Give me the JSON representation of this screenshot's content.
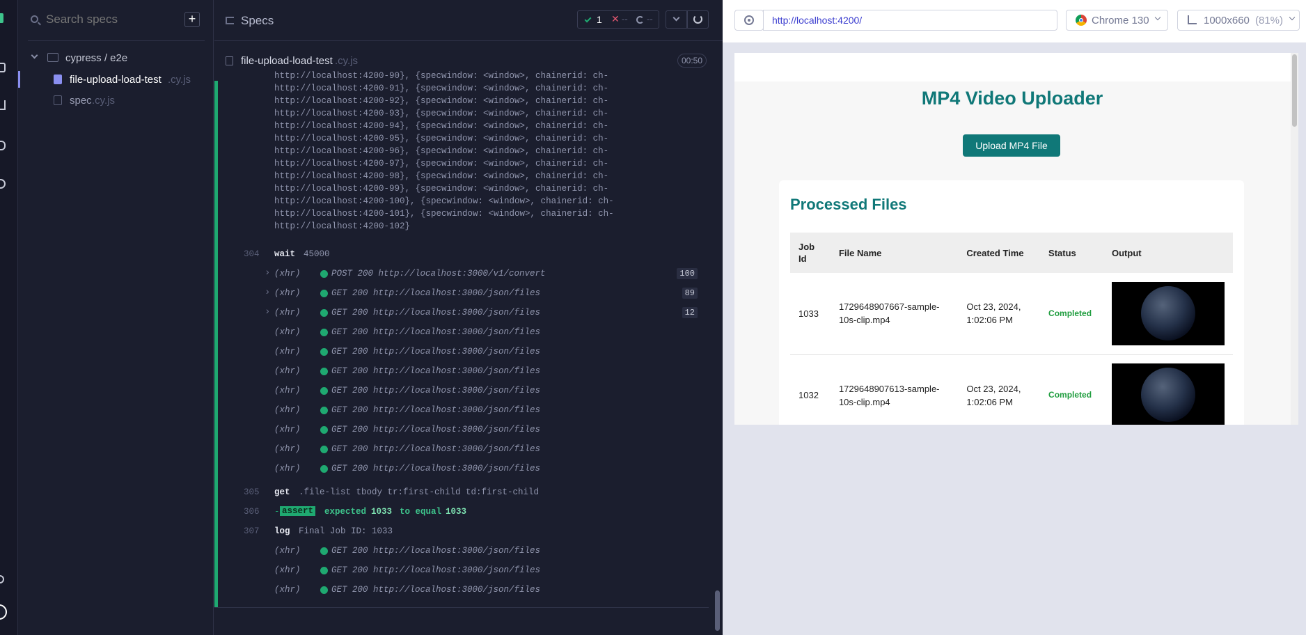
{
  "spec_list": {
    "search_placeholder": "Search specs",
    "add_label": "+",
    "folder": "cypress / e2e",
    "files": [
      {
        "name": "file-upload-load-test",
        "ext": ".cy.js"
      },
      {
        "name": "spec",
        "ext": ".cy.js"
      }
    ]
  },
  "runner": {
    "header_title": "Specs",
    "passed": "1",
    "failed": "--",
    "pending": "--",
    "spec_name": "file-upload-load-test",
    "spec_ext": ".cy.js",
    "duration": "00:50",
    "log_lines": [
      "http://localhost:4200-90}, {specwindow: <window>, chainerid: ch-",
      "http://localhost:4200-91}, {specwindow: <window>, chainerid: ch-",
      "http://localhost:4200-92}, {specwindow: <window>, chainerid: ch-",
      "http://localhost:4200-93}, {specwindow: <window>, chainerid: ch-",
      "http://localhost:4200-94}, {specwindow: <window>, chainerid: ch-",
      "http://localhost:4200-95}, {specwindow: <window>, chainerid: ch-",
      "http://localhost:4200-96}, {specwindow: <window>, chainerid: ch-",
      "http://localhost:4200-97}, {specwindow: <window>, chainerid: ch-",
      "http://localhost:4200-98}, {specwindow: <window>, chainerid: ch-",
      "http://localhost:4200-99}, {specwindow: <window>, chainerid: ch-",
      "http://localhost:4200-100}, {specwindow: <window>, chainerid: ch-",
      "http://localhost:4200-101}, {specwindow: <window>, chainerid: ch-",
      "http://localhost:4200-102}"
    ],
    "wait": {
      "num": "304",
      "cmd": "wait",
      "arg": "45000"
    },
    "xhr_group1": [
      {
        "text": "POST 200 http://localhost:3000/v1/convert",
        "count": "100"
      },
      {
        "text": "GET 200 http://localhost:3000/json/files",
        "count": "89"
      },
      {
        "text": "GET 200 http://localhost:3000/json/files",
        "count": "12"
      },
      {
        "text": "GET 200 http://localhost:3000/json/files",
        "count": ""
      },
      {
        "text": "GET 200 http://localhost:3000/json/files",
        "count": ""
      },
      {
        "text": "GET 200 http://localhost:3000/json/files",
        "count": ""
      },
      {
        "text": "GET 200 http://localhost:3000/json/files",
        "count": ""
      },
      {
        "text": "GET 200 http://localhost:3000/json/files",
        "count": ""
      },
      {
        "text": "GET 200 http://localhost:3000/json/files",
        "count": ""
      },
      {
        "text": "GET 200 http://localhost:3000/json/files",
        "count": ""
      },
      {
        "text": "GET 200 http://localhost:3000/json/files",
        "count": ""
      }
    ],
    "xhr_label": "(xhr)",
    "get_cmd": {
      "num": "305",
      "cmd": "get",
      "arg": ".file-list tbody tr:first-child td:first-child"
    },
    "assert_cmd": {
      "num": "306",
      "badge": "assert",
      "expected": "expected",
      "val1": "1033",
      "mid": "to equal",
      "val2": "1033"
    },
    "log_cmd": {
      "num": "307",
      "cmd": "log",
      "arg": "Final Job ID: 1033"
    },
    "xhr_group2": [
      "GET 200 http://localhost:3000/json/files",
      "GET 200 http://localhost:3000/json/files",
      "GET 200 http://localhost:3000/json/files"
    ]
  },
  "aut": {
    "url": "http://localhost:4200/",
    "browser": "Chrome 130",
    "viewport": "1000x660",
    "scale": "(81%)",
    "app_title": "MP4 Video Uploader",
    "upload_button": "Upload MP4 File",
    "processed_title": "Processed Files",
    "table_headers": [
      "Job Id",
      "File Name",
      "Created Time",
      "Status",
      "Output"
    ],
    "rows": [
      {
        "job_id": "1033",
        "file_name": "1729648907667-sample-10s-clip.mp4",
        "created": "Oct 23, 2024, 1:02:06 PM",
        "status": "Completed"
      },
      {
        "job_id": "1032",
        "file_name": "1729648907613-sample-10s-clip.mp4",
        "created": "Oct 23, 2024, 1:02:06 PM",
        "status": "Completed"
      }
    ]
  },
  "colors": {
    "accent": "#107878",
    "pass": "#1fa971",
    "link": "#3a3ccf"
  }
}
